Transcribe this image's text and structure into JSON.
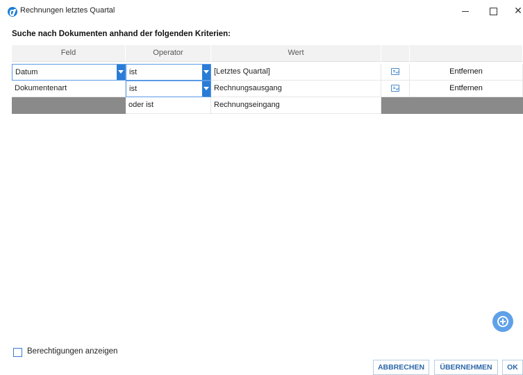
{
  "window": {
    "title": "Rechnungen letztes Quartal",
    "minimize": "",
    "maximize": "",
    "close": "✕"
  },
  "heading": "Suche nach Dokumenten anhand der folgenden Kriterien:",
  "table": {
    "headers": [
      "Feld",
      "Operator",
      "Wert",
      "",
      ""
    ],
    "rows": [
      {
        "field": "Datum",
        "operator": "ist",
        "value": "[Letztes Quartal]",
        "action": "Entfernen"
      },
      {
        "field": "Dokumentenart",
        "operator": "ist",
        "value": "Rechnungsausgang",
        "action": "Entfernen"
      },
      {
        "field": "",
        "operator": "oder ist",
        "value": "Rechnungseingang",
        "action": ""
      }
    ]
  },
  "icons": {
    "app": "app-logo-icon",
    "edit": "edit-value-icon",
    "add": "add-circle-icon",
    "dropdown": "dropdown-arrow-icon"
  },
  "checkbox": {
    "label": "Berechtigungen anzeigen",
    "checked": false
  },
  "buttons": {
    "cancel": "ABBRECHEN",
    "apply": "ÜBERNEHMEN",
    "ok": "OK"
  },
  "colors": {
    "accent": "#2a7cd6",
    "add_button": "#5fa1e8",
    "button_text": "#2b66a8",
    "row_fill": "#8a8a8a"
  }
}
